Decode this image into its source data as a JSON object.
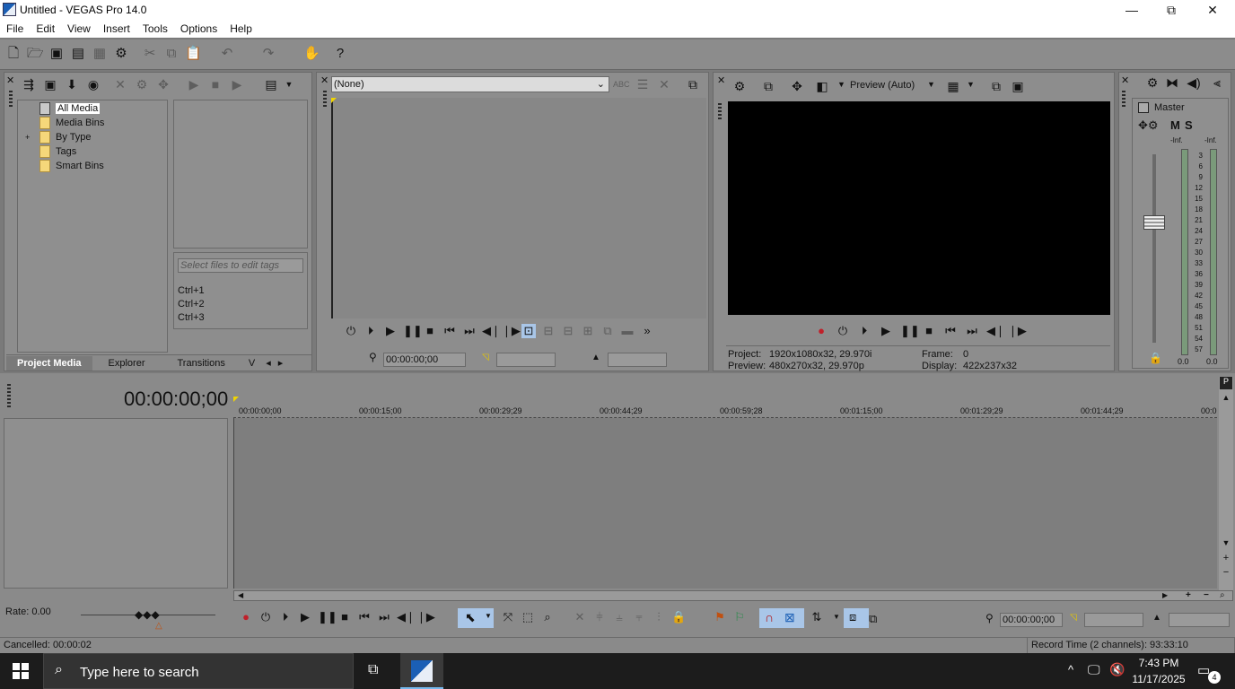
{
  "window": {
    "title": "Untitled - VEGAS Pro 14.0",
    "minimize": "—",
    "maximize": "⧉",
    "close": "✕"
  },
  "menu": [
    "File",
    "Edit",
    "View",
    "Insert",
    "Tools",
    "Options",
    "Help"
  ],
  "toolbar_icons": [
    "new-icon",
    "open-icon",
    "save-icon",
    "save-as-icon",
    "render-icon",
    "properties-icon",
    "cut-icon",
    "copy-icon",
    "paste-icon",
    "undo-icon",
    "redo-icon",
    "spectrum-icon",
    "whats-this-icon"
  ],
  "media": {
    "tree": [
      {
        "label": "All Media",
        "selected": true
      },
      {
        "label": "Media Bins"
      },
      {
        "label": "By Type",
        "expand": "+"
      },
      {
        "label": "Tags"
      },
      {
        "label": "Smart Bins"
      }
    ],
    "tag_placeholder": "Select files to edit tags",
    "shortcuts": [
      "Ctrl+1",
      "Ctrl+2",
      "Ctrl+3"
    ],
    "tabs": [
      "Project Media",
      "Explorer",
      "Transitions",
      "V"
    ]
  },
  "trimmer": {
    "dropdown": "(None)",
    "time_in": "00:00:00;00"
  },
  "preview": {
    "quality": "Preview (Auto)",
    "project_label": "Project:",
    "project_value": "1920x1080x32, 29.970i",
    "preview_label": "Preview:",
    "preview_value": "480x270x32, 29.970p",
    "frame_label": "Frame:",
    "frame_value": "0",
    "display_label": "Display:",
    "display_value": "422x237x32"
  },
  "master": {
    "label": "Master",
    "m": "M",
    "s": "S",
    "inf_left": "-Inf.",
    "inf_right": "-Inf.",
    "scale": [
      "3",
      "6",
      "9",
      "12",
      "15",
      "18",
      "21",
      "24",
      "27",
      "30",
      "33",
      "36",
      "39",
      "42",
      "45",
      "48",
      "51",
      "54",
      "57"
    ],
    "bottom_left": "0.0",
    "bottom_right": "0.0"
  },
  "timeline": {
    "cursor_time": "00:00:00;00",
    "ruler": [
      "00:00:00;00",
      "00:00:15;00",
      "00:00:29;29",
      "00:00:44;29",
      "00:00:59;28",
      "00:01:15;00",
      "00:01:29;29",
      "00:01:44;29",
      "00:0"
    ],
    "rate": "Rate: 0.00",
    "time_field": "00:00:00;00"
  },
  "status": {
    "left": "Cancelled: 00:00:02",
    "right": "Record Time (2 channels): 93:33:10"
  },
  "taskbar": {
    "search": "Type here to search",
    "time": "7:43 PM",
    "date": "11/17/2025",
    "notifications": "4"
  },
  "colors": {
    "panel": "#8d8d8d",
    "accent": "#1b5fb5",
    "preview_bg": "#000000"
  }
}
